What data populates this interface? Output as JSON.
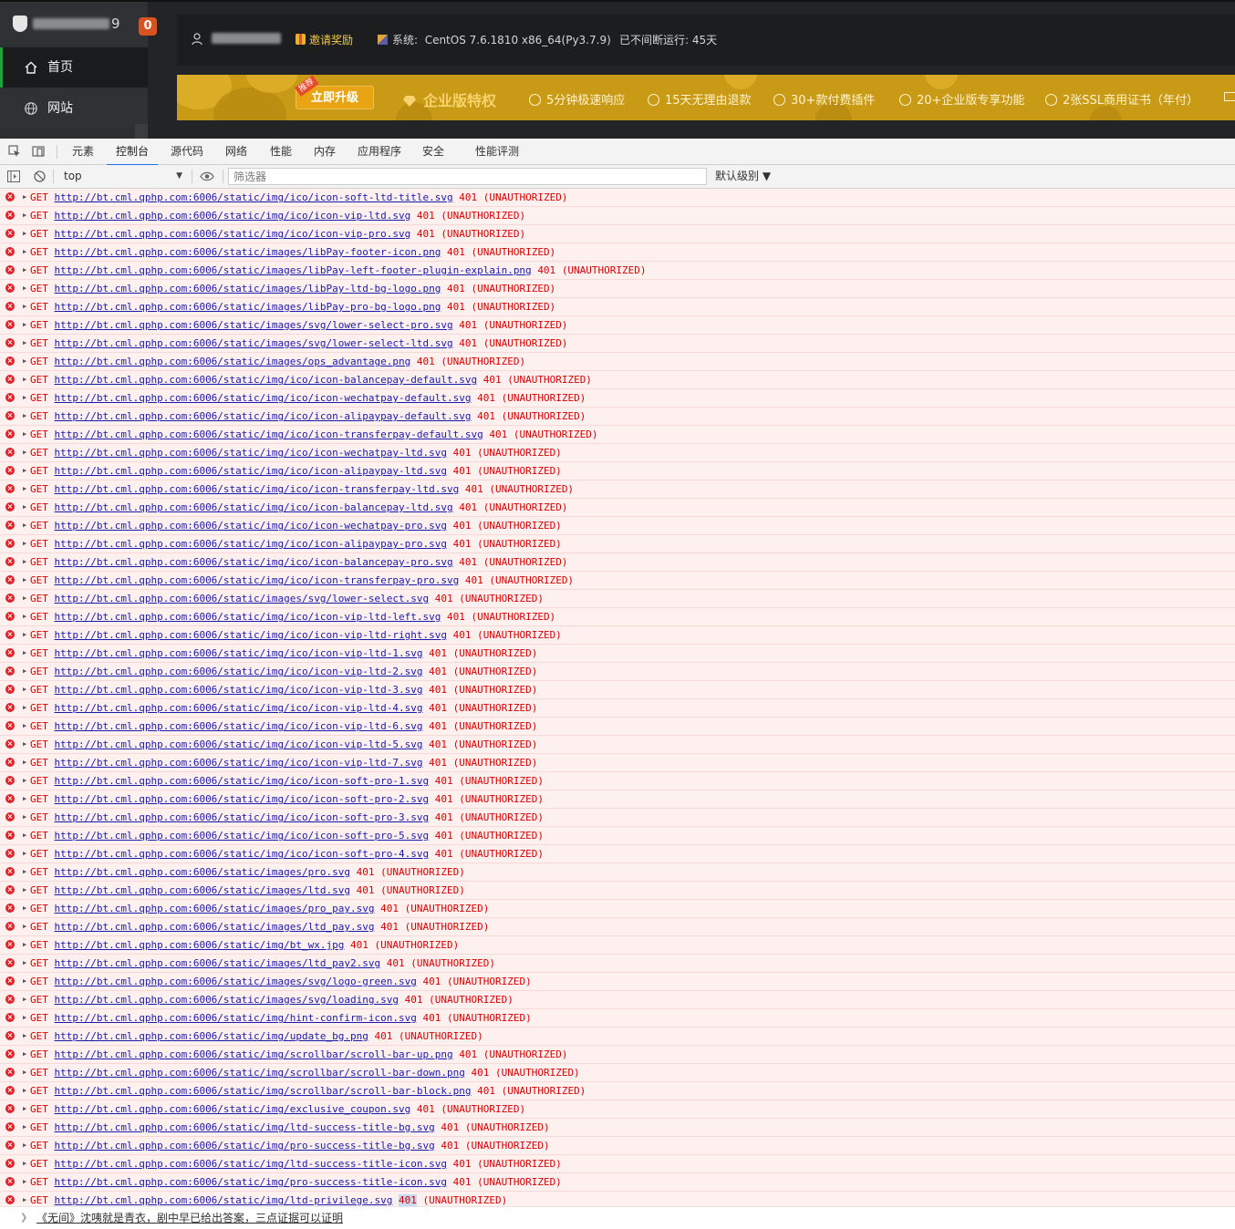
{
  "app": {
    "sidebar": {
      "title_tail": "9",
      "badge_count": "0",
      "nav": [
        {
          "label": "首页",
          "icon": "home-icon"
        },
        {
          "label": "网站",
          "icon": "globe-icon"
        }
      ]
    },
    "topbar": {
      "invite": "邀请奖励",
      "system_label": "系统:",
      "system_value": "CentOS 7.6.1810 x86_64(Py3.7.9)",
      "uptime": "已不间断运行: 45天"
    },
    "banner": {
      "recommend_tag": "推荐",
      "upgrade_button": "立即升级",
      "title": "企业版特权",
      "features": [
        "5分钟极速响应",
        "15天无理由退款",
        "30+款付费插件",
        "20+企业版专享功能",
        "2张SSL商用证书（年付）"
      ]
    }
  },
  "devtools": {
    "tabs": [
      "元素",
      "控制台",
      "源代码",
      "网络",
      "性能",
      "内存",
      "应用程序",
      "安全",
      "性能评测"
    ],
    "active_tab": "控制台",
    "context": "top",
    "filter_placeholder": "筛选器",
    "level": "默认级别 ▼",
    "url_prefix": "http://bt.cml.qphp.com:6006/static/",
    "log_paths": [
      "img/ico/icon-soft-ltd-title.svg",
      "img/ico/icon-vip-ltd.svg",
      "img/ico/icon-vip-pro.svg",
      "images/libPay-footer-icon.png",
      "images/libPay-left-footer-plugin-explain.png",
      "images/libPay-ltd-bg-logo.png",
      "images/libPay-pro-bg-logo.png",
      "images/svg/lower-select-pro.svg",
      "images/svg/lower-select-ltd.svg",
      "images/ops_advantage.png",
      "img/ico/icon-balancepay-default.svg",
      "img/ico/icon-wechatpay-default.svg",
      "img/ico/icon-alipaypay-default.svg",
      "img/ico/icon-transferpay-default.svg",
      "img/ico/icon-wechatpay-ltd.svg",
      "img/ico/icon-alipaypay-ltd.svg",
      "img/ico/icon-transferpay-ltd.svg",
      "img/ico/icon-balancepay-ltd.svg",
      "img/ico/icon-wechatpay-pro.svg",
      "img/ico/icon-alipaypay-pro.svg",
      "img/ico/icon-balancepay-pro.svg",
      "img/ico/icon-transferpay-pro.svg",
      "images/svg/lower-select.svg",
      "img/ico/icon-vip-ltd-left.svg",
      "img/ico/icon-vip-ltd-right.svg",
      "img/ico/icon-vip-ltd-1.svg",
      "img/ico/icon-vip-ltd-2.svg",
      "img/ico/icon-vip-ltd-3.svg",
      "img/ico/icon-vip-ltd-4.svg",
      "img/ico/icon-vip-ltd-6.svg",
      "img/ico/icon-vip-ltd-5.svg",
      "img/ico/icon-vip-ltd-7.svg",
      "img/ico/icon-soft-pro-1.svg",
      "img/ico/icon-soft-pro-2.svg",
      "img/ico/icon-soft-pro-3.svg",
      "img/ico/icon-soft-pro-5.svg",
      "img/ico/icon-soft-pro-4.svg",
      "images/pro.svg",
      "images/ltd.svg",
      "images/pro_pay.svg",
      "images/ltd_pay.svg",
      "img/bt_wx.jpg",
      "images/ltd_pay2.svg",
      "images/svg/logo-green.svg",
      "images/svg/loading.svg",
      "img/hint-confirm-icon.svg",
      "img/update_bg.png",
      "img/scrollbar/scroll-bar-up.png",
      "img/scrollbar/scroll-bar-down.png",
      "img/scrollbar/scroll-bar-block.png",
      "img/exclusive_coupon.svg",
      "img/ltd-success-title-bg.svg",
      "img/pro-success-title-bg.svg",
      "img/ltd-success-title-icon.svg",
      "img/pro-success-title-icon.svg",
      "img/ltd-privilege.svg"
    ],
    "log_method": "GET",
    "log_status": "401",
    "log_status_text": "(UNAUTHORIZED)",
    "highlighted_row_index": 55,
    "prompt_text": "《无间》沈咦就是青衣，剧中早已给出答案，三点证据可以证明"
  }
}
